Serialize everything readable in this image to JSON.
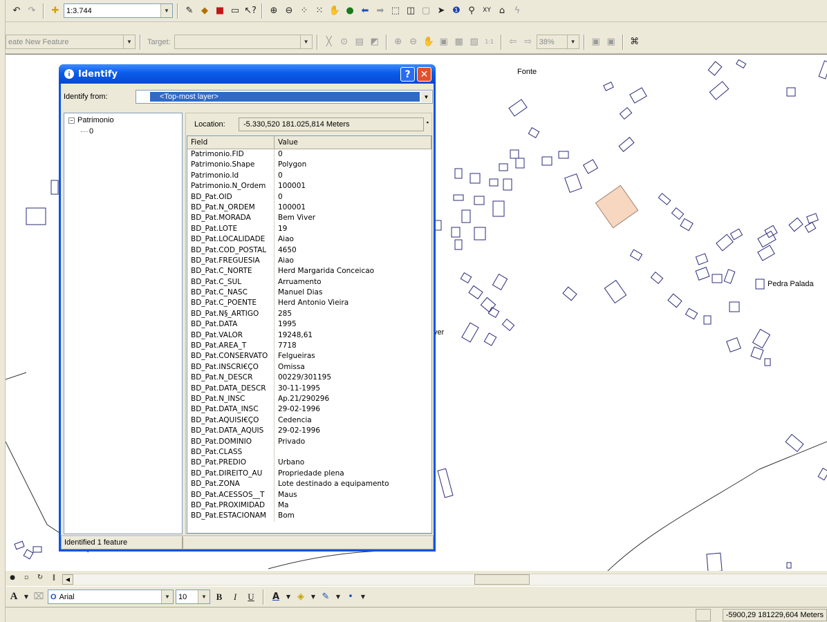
{
  "toolbar1": {
    "scale_value": "1:3.744",
    "icons": [
      "undo-icon",
      "redo-icon",
      "add-data-icon",
      "editor-icon",
      "arctoolbox-icon",
      "toolbox-icon",
      "command-line-icon",
      "whats-this-icon",
      "zoom-in-icon",
      "zoom-out-icon",
      "fixed-zoom-in-icon",
      "fixed-zoom-out-icon",
      "pan-icon",
      "full-extent-icon",
      "back-icon",
      "forward-icon",
      "select-features-icon",
      "clear-selection-icon",
      "select-elements-icon",
      "identify-icon",
      "find-icon",
      "go-to-xy-icon",
      "measure-icon",
      "hyperlink-icon"
    ]
  },
  "toolbar2": {
    "task_value": "eate New Feature",
    "target_label": "Target:",
    "target_value": "",
    "zoom_value": "38%"
  },
  "map": {
    "labels": [
      "Fonte",
      "Pedra Palada",
      "ver"
    ]
  },
  "dialog": {
    "title": "Identify",
    "identify_from_label": "Identify from:",
    "layer_value": "<Top-most layer>",
    "tree": {
      "layer": "Patrimonio",
      "feature": "0"
    },
    "location_label": "Location:",
    "location_value": "-5.330,520  181.025,814 Meters",
    "columns": {
      "field": "Field",
      "value": "Value"
    },
    "rows": [
      [
        "Patrimonio.FID",
        "0"
      ],
      [
        "Patrimonio.Shape",
        "Polygon"
      ],
      [
        "Patrimonio.Id",
        "0"
      ],
      [
        "Patrimonio.N_Ordem",
        "100001"
      ],
      [
        "BD_Pat.OID",
        "0"
      ],
      [
        "BD_Pat.N_ORDEM",
        "100001"
      ],
      [
        "BD_Pat.MORADA",
        "Bem Viver"
      ],
      [
        "BD_Pat.LOTE",
        "19"
      ],
      [
        "BD_Pat.LOCALIDADE",
        "Aiao"
      ],
      [
        "BD_Pat.COD_POSTAL",
        "4650"
      ],
      [
        "BD_Pat.FREGUESIA",
        "Aiao"
      ],
      [
        "BD_Pat.C_NORTE",
        "Herd Margarida Conceicao"
      ],
      [
        "BD_Pat.C_SUL",
        "Arruamento"
      ],
      [
        "BD_Pat.C_NASC",
        "Manuel Dias"
      ],
      [
        "BD_Pat.C_POENTE",
        "Herd Antonio Vieira"
      ],
      [
        "BD_Pat.N§_ARTIGO",
        "285"
      ],
      [
        "BD_Pat.DATA",
        "1995"
      ],
      [
        "BD_Pat.VALOR",
        "19248,61"
      ],
      [
        "BD_Pat.AREA_T",
        "7718"
      ],
      [
        "BD_Pat.CONSERVATO",
        "Felgueiras"
      ],
      [
        "BD_Pat.INSCRI€ÇO",
        "Omissa"
      ],
      [
        "BD_Pat.N_DESCR",
        "00229/301195"
      ],
      [
        "BD_Pat.DATA_DESCR",
        "30-11-1995"
      ],
      [
        "BD_Pat.N_INSC",
        "Ap.21/290296"
      ],
      [
        "BD_Pat.DATA_INSC",
        "29-02-1996"
      ],
      [
        "BD_Pat.AQUISI€ÇO",
        "Cedencia"
      ],
      [
        "BD_Pat.DATA_AQUIS",
        "29-02-1996"
      ],
      [
        "BD_Pat.DOMINIO",
        "Privado"
      ],
      [
        "BD_Pat.CLASS",
        ""
      ],
      [
        "BD_Pat.PREDIO",
        "Urbano"
      ],
      [
        "BD_Pat.DIREITO_AU",
        "Propriedade plena"
      ],
      [
        "BD_Pat.ZONA",
        "Lote destinado a equipamento"
      ],
      [
        "BD_Pat.ACESSOS__T",
        "Maus"
      ],
      [
        "BD_Pat.PROXIMIDAD",
        "Ma"
      ],
      [
        "BD_Pat.ESTACIONAM",
        "Bom"
      ]
    ],
    "status": "Identified 1 feature"
  },
  "drawing_toolbar": {
    "font_value": "Arial",
    "size_value": "10",
    "bold": "B",
    "italic": "I",
    "underline": "U"
  },
  "statusbar": {
    "coordinates": "-5900,29  181229,604 Meters"
  },
  "colors": {
    "selection_fill": "#f7d7bf",
    "parcel_outline": "#2a2a7a",
    "title_bar": "#0a5ce9"
  }
}
